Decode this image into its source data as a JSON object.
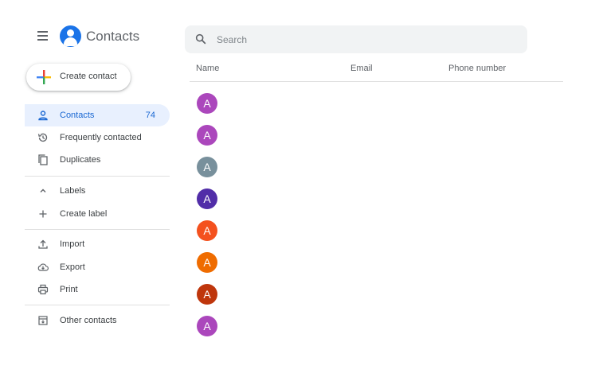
{
  "header": {
    "app_title": "Contacts"
  },
  "search": {
    "placeholder": "Search"
  },
  "create_button": {
    "label": "Create contact"
  },
  "sidebar": {
    "contacts": {
      "label": "Contacts",
      "count": "74"
    },
    "frequently_contacted": {
      "label": "Frequently contacted"
    },
    "duplicates": {
      "label": "Duplicates"
    },
    "labels": {
      "label": "Labels"
    },
    "create_label": {
      "label": "Create label"
    },
    "import": {
      "label": "Import"
    },
    "export": {
      "label": "Export"
    },
    "print": {
      "label": "Print"
    },
    "other_contacts": {
      "label": "Other contacts"
    }
  },
  "table": {
    "columns": [
      "Name",
      "Email",
      "Phone number"
    ],
    "rows": [
      {
        "initial": "A",
        "color": "#ab47bc"
      },
      {
        "initial": "A",
        "color": "#ab47bc"
      },
      {
        "initial": "A",
        "color": "#78909c"
      },
      {
        "initial": "A",
        "color": "#512da8"
      },
      {
        "initial": "A",
        "color": "#f4511e"
      },
      {
        "initial": "A",
        "color": "#ef6c00"
      },
      {
        "initial": "A",
        "color": "#bf360c"
      },
      {
        "initial": "A",
        "color": "#ab47bc"
      }
    ]
  },
  "colors": {
    "accent": "#1a73e8",
    "active_bg": "#e8f0fe",
    "active_text": "#1967d2"
  }
}
